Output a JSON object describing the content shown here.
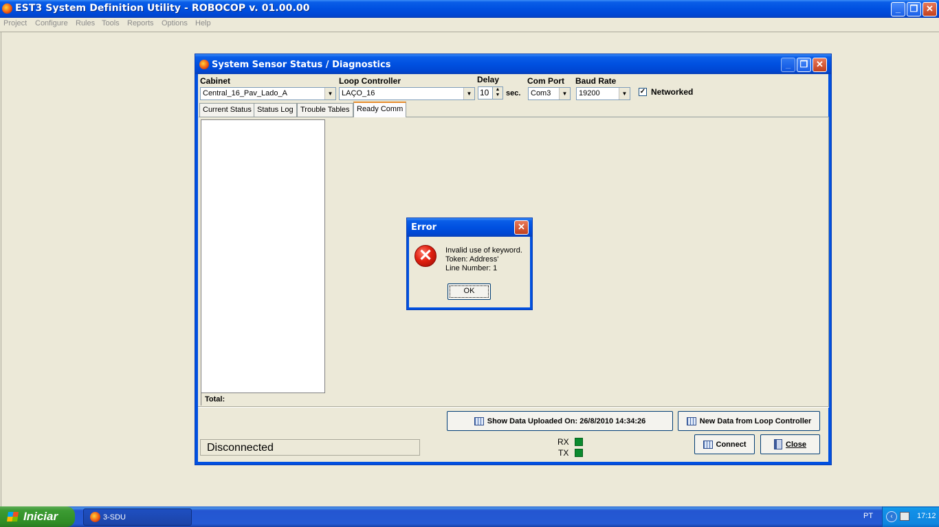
{
  "app": {
    "title": "EST3 System Definition Utility - ROBOCOP v. 01.00.00",
    "window_buttons": {
      "minimize": "_",
      "restore": "❐",
      "close": "✕"
    }
  },
  "menu": [
    "Project",
    "Configure",
    "Rules",
    "Tools",
    "Reports",
    "Options",
    "Help"
  ],
  "child": {
    "title": "System Sensor Status / Diagnostics",
    "cabinet_label": "Cabinet",
    "cabinet_value": "Central_16_Pav_Lado_A",
    "loop_label": "Loop Controller",
    "loop_value": "LAÇO_16",
    "delay_label": "Delay",
    "delay_value": "10",
    "delay_unit": "sec.",
    "comport_label": "Com Port",
    "comport_value": "Com3",
    "baud_label": "Baud Rate",
    "baud_value": "19200",
    "networked_label": "Networked",
    "networked_checked": "✓",
    "tabs": [
      "Current Status",
      "Status Log",
      "Trouble Tables",
      "Ready Comm"
    ],
    "total_label": "Total:",
    "show_data_button": "Show Data Uploaded On: 26/8/2010 14:34:26",
    "new_data_button": "New Data from Loop Controller",
    "connect_button": "Connect",
    "close_button": "Close",
    "status": "Disconnected",
    "rx_label": "RX",
    "tx_label": "TX"
  },
  "dialog": {
    "title": "Error",
    "line1": "Invalid use of keyword.",
    "line2": "Token: Address'",
    "line3": "Line Number: 1",
    "ok": "OK"
  },
  "taskbar": {
    "start": "Iniciar",
    "task": "3-SDU",
    "lang": "PT",
    "clock": "17:12"
  },
  "colors": {
    "titlebar": "#0050e0",
    "led": "#0b8a2e",
    "error_icon": "#e02010",
    "start_button": "#3c9b33"
  }
}
